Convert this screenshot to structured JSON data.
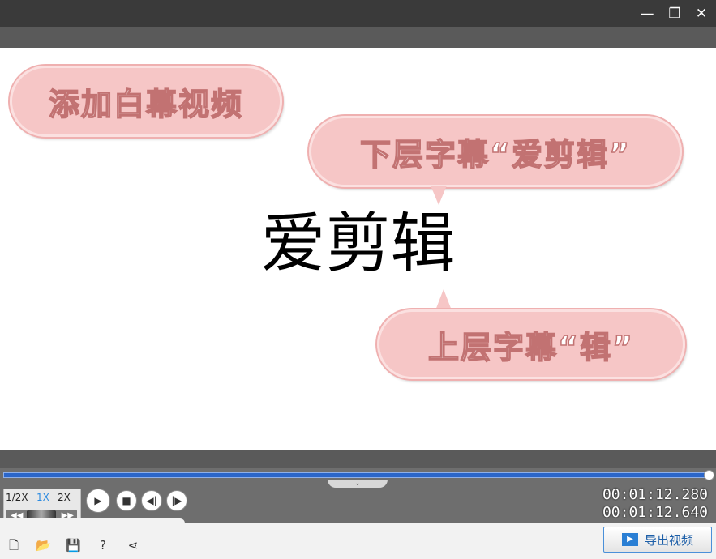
{
  "window": {
    "controls": {
      "minimize": "—",
      "restore": "❐",
      "close": "✕"
    }
  },
  "canvas": {
    "main_text": "爱剪辑",
    "bubbles": [
      {
        "text": "添加白幕视频"
      },
      {
        "text": "下层字幕“爱剪辑”"
      },
      {
        "text": "上层字幕“辑”"
      }
    ]
  },
  "player": {
    "progress": 0.995,
    "speeds": [
      "1/2X",
      "1X",
      "2X"
    ],
    "active_speed": "1X",
    "current_time": "00:01:12.280",
    "total_time": "00:01:12.640",
    "volume": 0.95
  },
  "toolbar": {
    "icons": [
      "new-project-icon",
      "open-folder-icon",
      "save-icon",
      "help-icon",
      "share-icon"
    ],
    "export_label": "导出视频"
  },
  "colors": {
    "accent": "#2b66c9",
    "bubble": "#f6c6c6"
  }
}
